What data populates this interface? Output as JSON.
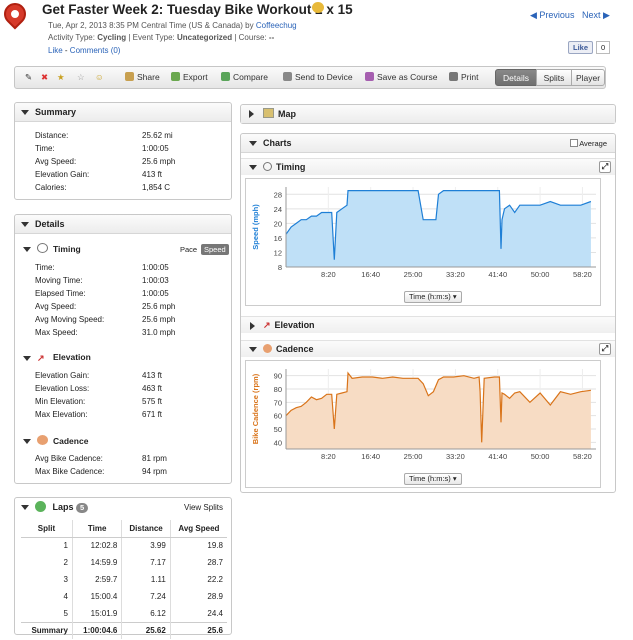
{
  "header": {
    "title": "Get Faster Week 2: Tuesday Bike Workout 2 x 15",
    "datetime": "Tue, Apr 2, 2013 8:35 PM Central Time (US & Canada)",
    "by_label": "by",
    "user": "Coffeechug",
    "activity_type_label": "Activity Type:",
    "activity_type": "Cycling",
    "event_type_label": "Event Type:",
    "event_type": "Uncategorized",
    "course_label": "Course:",
    "course": "--",
    "like_link": "Like",
    "comments_link": "Comments (0)",
    "prev": "Previous",
    "next": "Next",
    "fb_like": "Like",
    "fb_count": "0"
  },
  "toolbar": {
    "share": "Share",
    "export": "Export",
    "compare": "Compare",
    "send": "Send to Device",
    "save_course": "Save as Course",
    "print": "Print",
    "tabs": [
      "Details",
      "Splits",
      "Player"
    ],
    "active_tab": "Details"
  },
  "summary": {
    "title": "Summary",
    "rows": [
      {
        "k": "Distance:",
        "v": "25.62 mi"
      },
      {
        "k": "Time:",
        "v": "1:00:05"
      },
      {
        "k": "Avg Speed:",
        "v": "25.6 mph"
      },
      {
        "k": "Elevation Gain:",
        "v": "413 ft"
      },
      {
        "k": "Calories:",
        "v": "1,854 C"
      }
    ]
  },
  "details": {
    "title": "Details",
    "timing": {
      "title": "Timing",
      "pace": "Pace",
      "speed": "Speed",
      "rows": [
        {
          "k": "Time:",
          "v": "1:00:05"
        },
        {
          "k": "Moving Time:",
          "v": "1:00:03"
        },
        {
          "k": "Elapsed Time:",
          "v": "1:00:05"
        },
        {
          "k": "Avg Speed:",
          "v": "25.6 mph"
        },
        {
          "k": "Avg Moving Speed:",
          "v": "25.6 mph"
        },
        {
          "k": "Max Speed:",
          "v": "31.0 mph"
        }
      ]
    },
    "elevation": {
      "title": "Elevation",
      "rows": [
        {
          "k": "Elevation Gain:",
          "v": "413 ft"
        },
        {
          "k": "Elevation Loss:",
          "v": "463 ft"
        },
        {
          "k": "Min Elevation:",
          "v": "575 ft"
        },
        {
          "k": "Max Elevation:",
          "v": "671 ft"
        }
      ]
    },
    "cadence": {
      "title": "Cadence",
      "rows": [
        {
          "k": "Avg Bike Cadence:",
          "v": "81 rpm"
        },
        {
          "k": "Max Bike Cadence:",
          "v": "94 rpm"
        }
      ]
    }
  },
  "laps": {
    "title": "Laps",
    "count": "5",
    "view_splits": "View Splits",
    "headers": [
      "Split",
      "Time",
      "Distance",
      "Avg Speed"
    ],
    "rows": [
      [
        "1",
        "12:02.8",
        "3.99",
        "19.8"
      ],
      [
        "2",
        "14:59.9",
        "7.17",
        "28.7"
      ],
      [
        "3",
        "2:59.7",
        "1.11",
        "22.2"
      ],
      [
        "4",
        "15:00.4",
        "7.24",
        "28.9"
      ],
      [
        "5",
        "15:01.9",
        "6.12",
        "24.4"
      ]
    ],
    "summary": [
      "Summary",
      "1:00:04.6",
      "25.62",
      "25.6"
    ]
  },
  "right": {
    "map": "Map",
    "charts": "Charts",
    "average": "Average",
    "timing": "Timing",
    "elevation": "Elevation",
    "cadence": "Cadence",
    "time_select": "Time (h:m:s)"
  },
  "colors": {
    "speed": "#1e7fd6",
    "speed_fill": "#bfe0f7",
    "cadence": "#d9741a",
    "cadence_fill": "#f7dcc4"
  },
  "chart_data": [
    {
      "type": "area",
      "title": "Timing",
      "ylabel": "Speed (mph)",
      "xlabel": "Time (h:m:s)",
      "x_ticks": [
        "8:20",
        "16:40",
        "25:00",
        "33:20",
        "41:40",
        "50:00",
        "58:20"
      ],
      "y_ticks": [
        8,
        12,
        16,
        20,
        24,
        28
      ],
      "ylim": [
        8,
        30
      ],
      "xlim": [
        0,
        61
      ],
      "x_minutes": [
        0,
        1,
        2,
        3,
        4,
        5,
        6,
        7,
        8,
        9,
        9.5,
        10,
        11,
        12,
        12.2,
        13,
        15,
        17,
        19,
        21,
        23,
        25,
        26,
        27,
        27.2,
        28,
        29,
        29.5,
        30,
        31,
        33,
        35,
        37,
        39,
        41,
        42,
        42.3,
        42.5,
        43,
        44,
        45,
        46,
        48,
        50,
        52,
        54,
        56,
        58,
        60
      ],
      "values": [
        17,
        19,
        20,
        21,
        21,
        22,
        22,
        23,
        23,
        23,
        10,
        23,
        24,
        25,
        29,
        29,
        29,
        29,
        29,
        29,
        29,
        29,
        29,
        21,
        21,
        21,
        21,
        21,
        28,
        29,
        29,
        29,
        29,
        29,
        29,
        29,
        13,
        21,
        24,
        25,
        23,
        25,
        25,
        25,
        26,
        25,
        25,
        25,
        26
      ]
    },
    {
      "type": "area",
      "title": "Cadence",
      "ylabel": "Bike Cadence (rpm)",
      "xlabel": "Time (h:m:s)",
      "x_ticks": [
        "8:20",
        "16:40",
        "25:00",
        "33:20",
        "41:40",
        "50:00",
        "58:20"
      ],
      "y_ticks": [
        40,
        50,
        60,
        70,
        80,
        90
      ],
      "ylim": [
        35,
        95
      ],
      "xlim": [
        0,
        61
      ],
      "x_minutes": [
        0,
        1,
        2,
        3,
        4,
        5,
        6,
        7,
        8,
        9,
        9.5,
        10,
        11,
        12,
        12.2,
        13,
        15,
        17,
        19,
        21,
        23,
        25,
        26,
        27,
        28,
        29,
        30,
        31,
        33,
        35,
        37,
        38,
        38.2,
        38.5,
        39,
        41,
        42,
        42.3,
        42.5,
        43,
        44,
        45,
        46,
        48,
        50,
        52,
        54,
        56,
        58,
        60
      ],
      "values": [
        60,
        64,
        66,
        67,
        70,
        74,
        72,
        73,
        76,
        76,
        50,
        76,
        77,
        78,
        92,
        88,
        89,
        89,
        88,
        89,
        88,
        88,
        88,
        84,
        75,
        78,
        87,
        89,
        89,
        90,
        88,
        89,
        78,
        40,
        88,
        89,
        89,
        55,
        77,
        76,
        73,
        77,
        78,
        70,
        77,
        68,
        78,
        76,
        78,
        79
      ]
    }
  ]
}
